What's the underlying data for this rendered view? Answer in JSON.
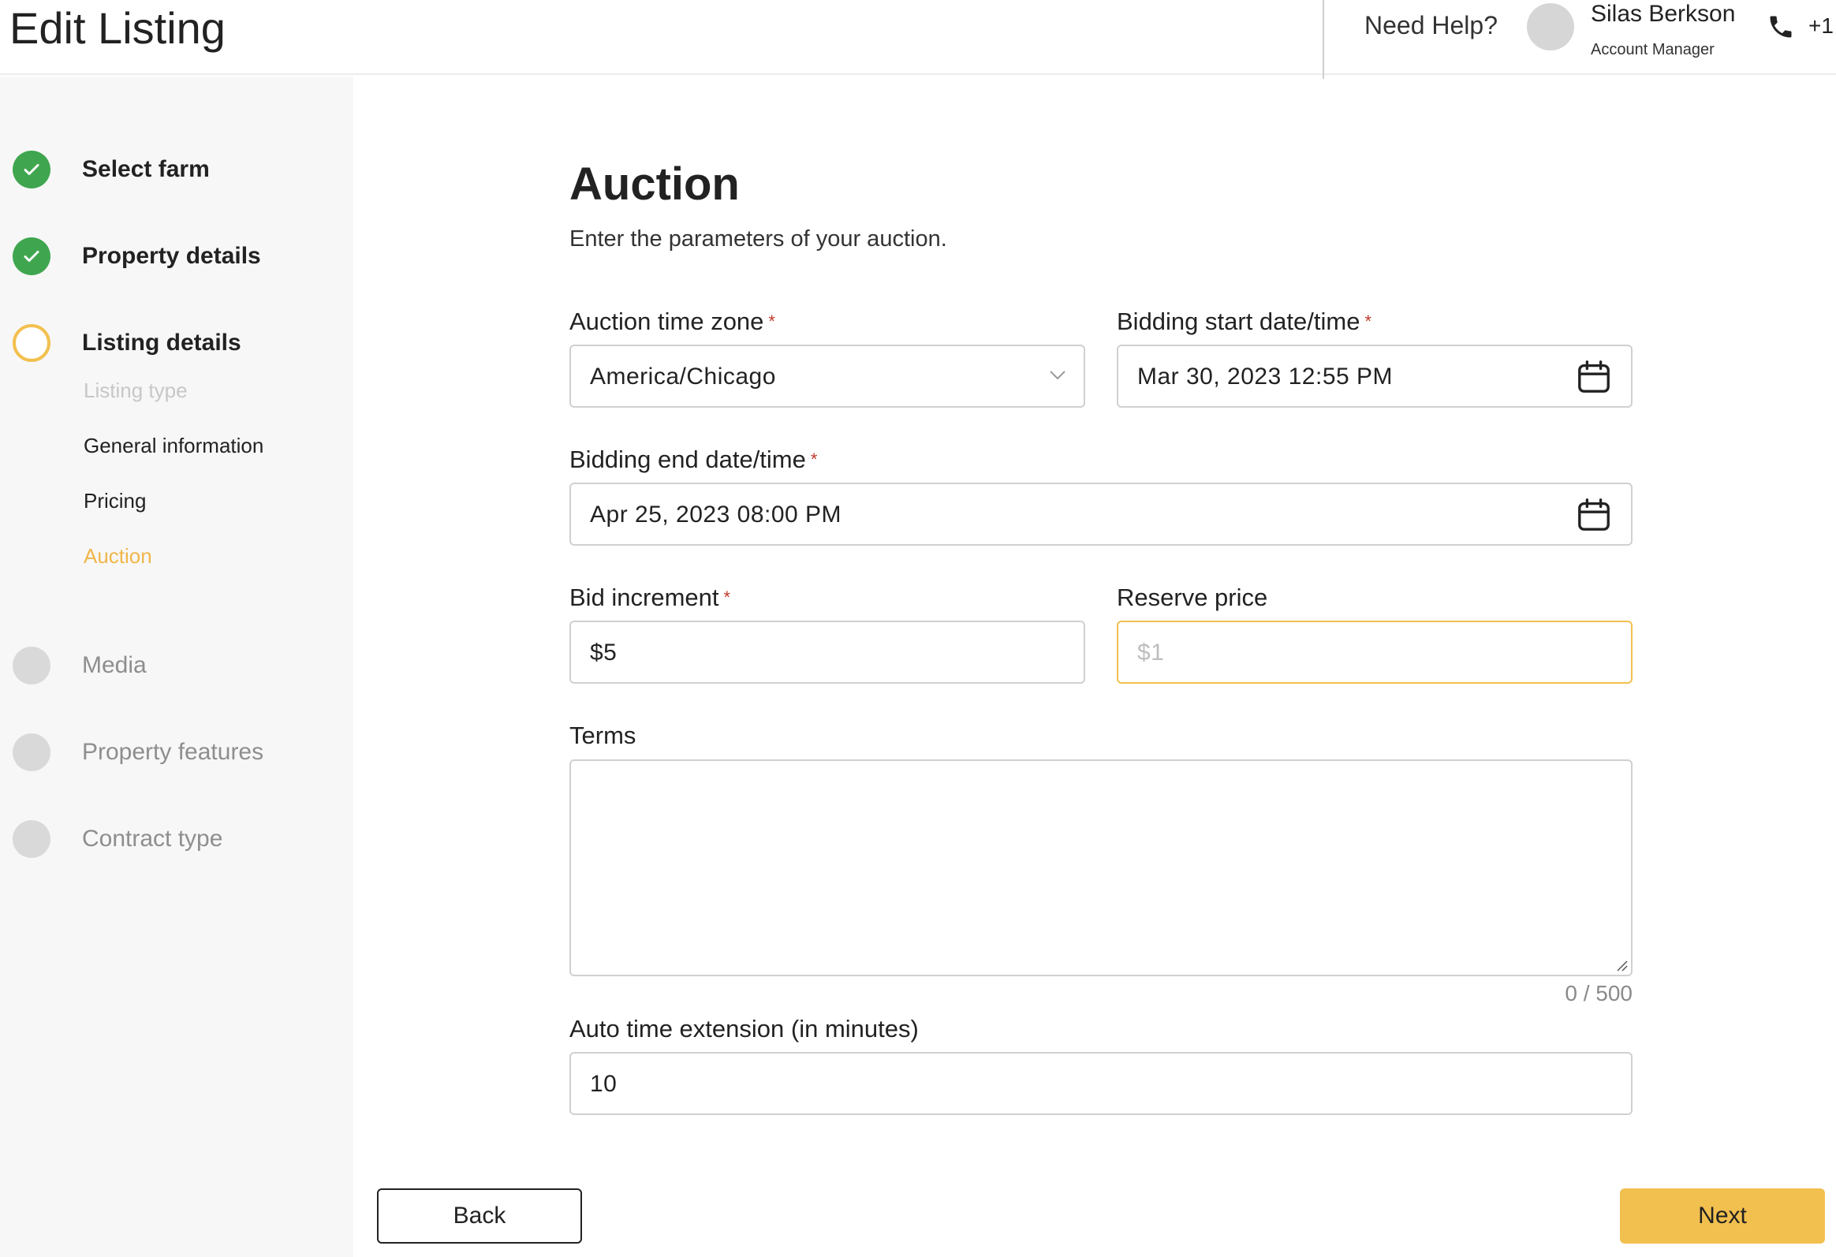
{
  "header": {
    "title": "Edit Listing",
    "need_help": "Need Help?",
    "manager_name": "Silas Berkson",
    "manager_role": "Account Manager",
    "phone_prefix": "+1"
  },
  "sidebar": {
    "steps": [
      {
        "label": "Select farm",
        "status": "completed"
      },
      {
        "label": "Property details",
        "status": "completed"
      },
      {
        "label": "Listing details",
        "status": "current"
      },
      {
        "label": "Media",
        "status": "pending"
      },
      {
        "label": "Property features",
        "status": "pending"
      },
      {
        "label": "Contract type",
        "status": "pending"
      }
    ],
    "substeps": [
      {
        "label": "Listing type",
        "state": "disabled"
      },
      {
        "label": "General information",
        "state": "normal"
      },
      {
        "label": "Pricing",
        "state": "normal"
      },
      {
        "label": "Auction",
        "state": "active"
      }
    ]
  },
  "form": {
    "title": "Auction",
    "subtitle": "Enter the parameters of your auction.",
    "required_mark": "*",
    "timezone": {
      "label": "Auction time zone",
      "value": "America/Chicago"
    },
    "start": {
      "label": "Bidding start date/time",
      "value": "Mar 30, 2023 12:55 PM"
    },
    "end": {
      "label": "Bidding end date/time",
      "value": "Apr 25, 2023 08:00 PM"
    },
    "increment": {
      "label": "Bid increment",
      "value": "$5"
    },
    "reserve": {
      "label": "Reserve price",
      "placeholder": "$1"
    },
    "terms": {
      "label": "Terms",
      "count": "0 / 500"
    },
    "extension": {
      "label": "Auto time extension (in minutes)",
      "value": "10"
    }
  },
  "actions": {
    "back": "Back",
    "next": "Next"
  },
  "colors": {
    "accent": "#f2c04f",
    "success": "#3fa64f",
    "required": "#c0392b"
  }
}
